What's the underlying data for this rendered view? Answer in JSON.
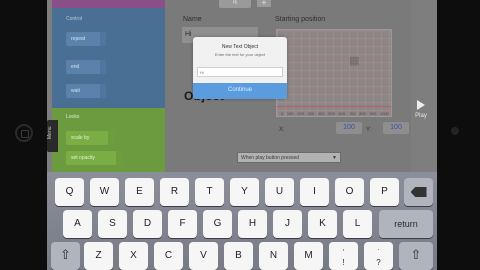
{
  "palette": {
    "section_control": "Control",
    "control_blocks": [
      "repeat",
      "end",
      "wait"
    ],
    "section_looks": "Looks",
    "looks_blocks": [
      "scale by",
      "set opacity"
    ],
    "menu_tab": "Menu"
  },
  "workspace": {
    "tab_label": "Hi",
    "tab_add": "+",
    "name_label": "Name",
    "name_value": "Hi",
    "start_label": "Starting position",
    "x_label": "X:",
    "x_value": "100",
    "y_label": "Y:",
    "y_value": "100",
    "object_heading": "Object",
    "when_select": "When play button pressed",
    "grid_ticks": [
      "0",
      "100",
      "200",
      "300",
      "400",
      "500",
      "600",
      "700",
      "800",
      "900",
      "1000"
    ]
  },
  "modal": {
    "title": "New Text Object",
    "message": "Enter the text for your object",
    "input_value": "Hi",
    "button": "Continue"
  },
  "play": {
    "label": "Play"
  },
  "keyboard": {
    "row1": [
      "Q",
      "W",
      "E",
      "R",
      "T",
      "Y",
      "U",
      "I",
      "O",
      "P"
    ],
    "row2": [
      "A",
      "S",
      "D",
      "F",
      "G",
      "H",
      "J",
      "K",
      "L"
    ],
    "row3": [
      "Z",
      "X",
      "C",
      "V",
      "B",
      "N",
      "M",
      "!",
      "?"
    ],
    "row3_punct_top": [
      ",",
      "."
    ],
    "return_label": "return",
    "shift_glyph": "⇧"
  }
}
